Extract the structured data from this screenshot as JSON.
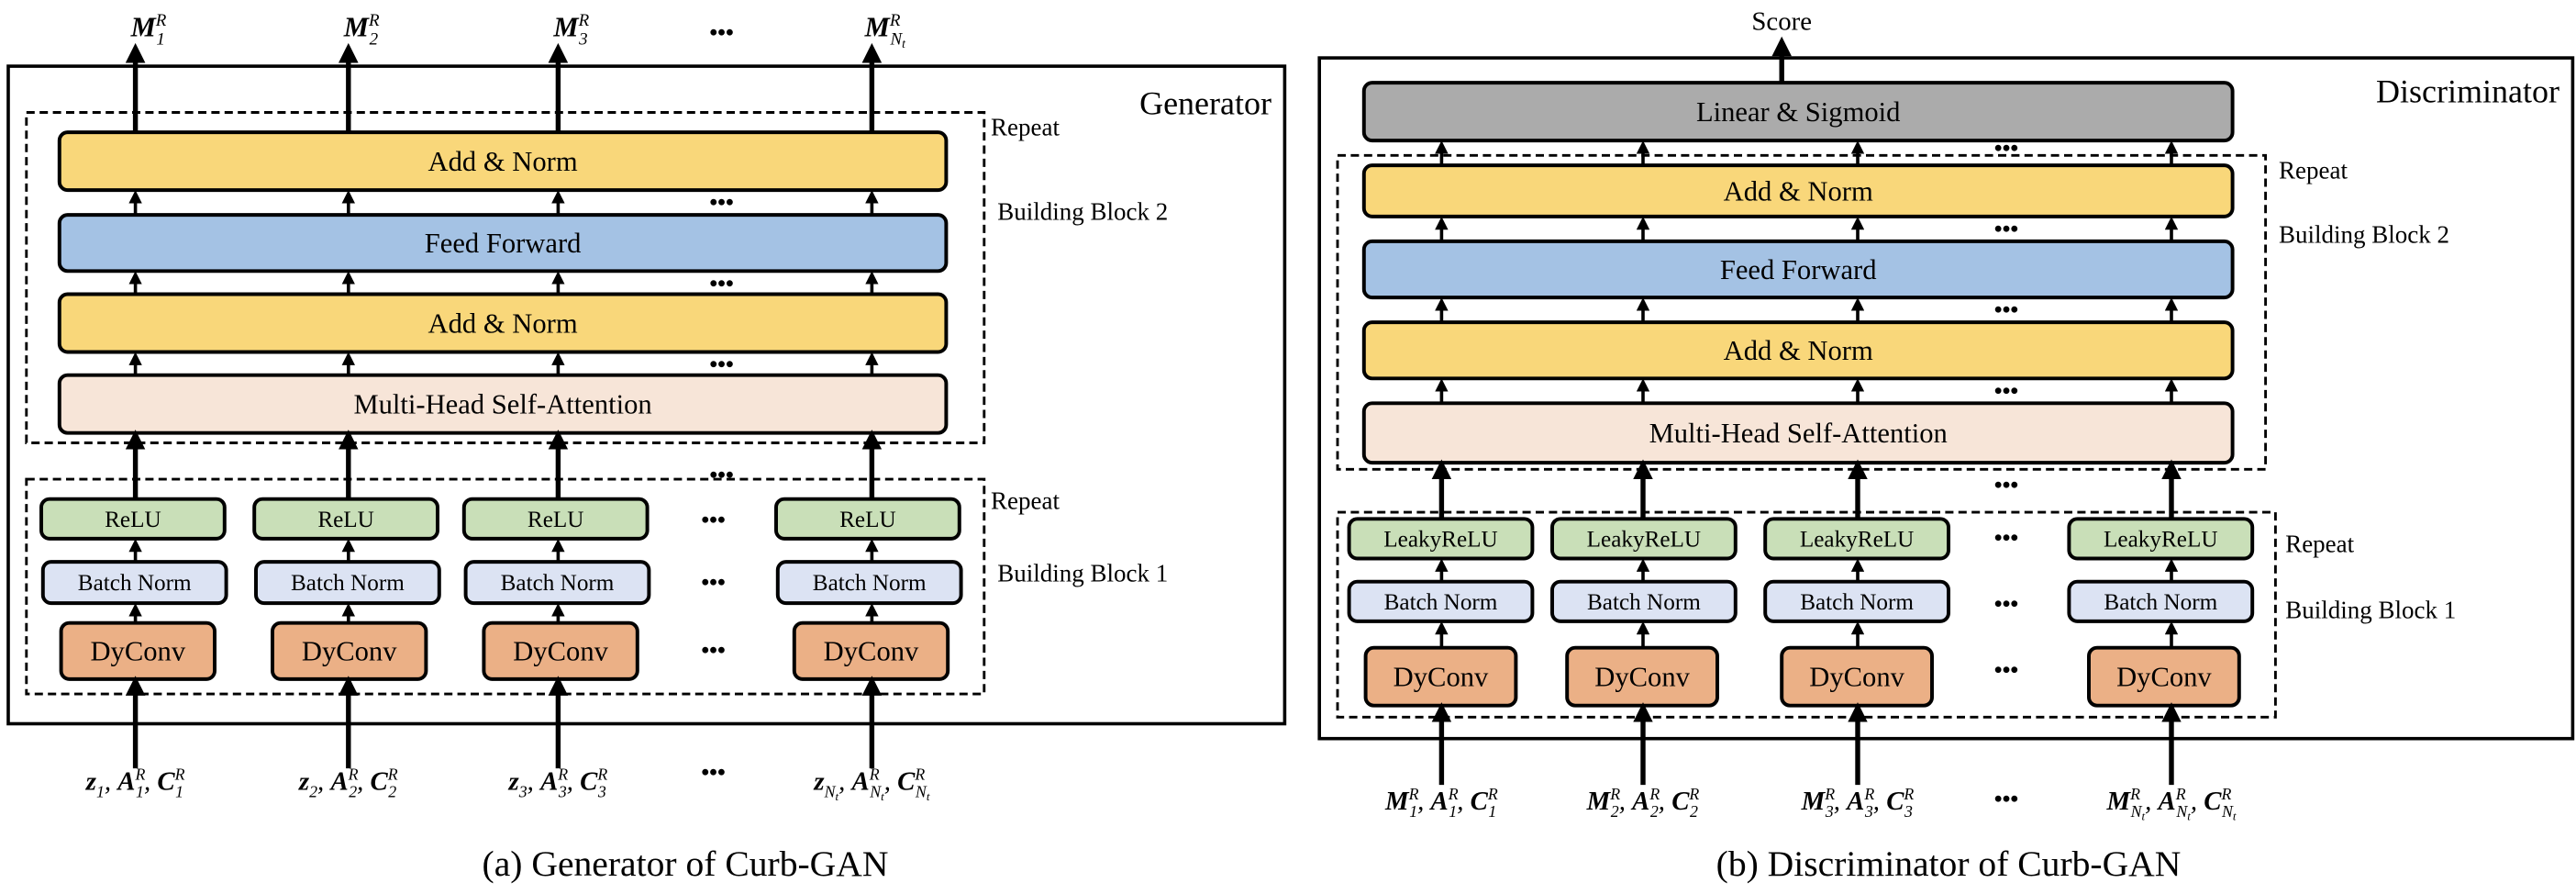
{
  "colors": {
    "add_norm": "#F9D77A",
    "feed_forward": "#A4C2E4",
    "attention": "#F7E5D8",
    "activation": "#C9DFB8",
    "batch_norm": "#DCE3F3",
    "dyconv": "#EBB086",
    "linear_sigmoid": "#ABABAB"
  },
  "ellipsis": "•••",
  "generator": {
    "title": "Generator",
    "caption": "(a) Generator of Curb-GAN",
    "block2": {
      "repeat": "Repeat",
      "label": "Building Block 2",
      "layers": [
        "Add & Norm",
        "Feed Forward",
        "Add & Norm",
        "Multi-Head Self-Attention"
      ]
    },
    "block1": {
      "repeat": "Repeat",
      "label": "Building Block 1",
      "activation": "ReLU",
      "norm": "Batch Norm",
      "conv": "DyConv"
    },
    "outputs": [
      [
        {
          "b": "M",
          "sup": "R",
          "sub": "1"
        }
      ],
      [
        {
          "b": "M",
          "sup": "R",
          "sub": "2"
        }
      ],
      [
        {
          "b": "M",
          "sup": "R",
          "sub": "3"
        }
      ],
      [
        {
          "b": "M",
          "sup": "R",
          "sub": "N",
          "subsub": "t"
        }
      ]
    ],
    "inputs": [
      [
        {
          "b": "z",
          "sub": "1"
        },
        {
          "b": "A",
          "sup": "R",
          "sub": "1"
        },
        {
          "b": "C",
          "sup": "R",
          "sub": "1"
        }
      ],
      [
        {
          "b": "z",
          "sub": "2"
        },
        {
          "b": "A",
          "sup": "R",
          "sub": "2"
        },
        {
          "b": "C",
          "sup": "R",
          "sub": "2"
        }
      ],
      [
        {
          "b": "z",
          "sub": "3"
        },
        {
          "b": "A",
          "sup": "R",
          "sub": "3"
        },
        {
          "b": "C",
          "sup": "R",
          "sub": "3"
        }
      ],
      [
        {
          "b": "z",
          "sub": "N",
          "subsub": "t"
        },
        {
          "b": "A",
          "sup": "R",
          "sub": "N",
          "subsub": "t"
        },
        {
          "b": "C",
          "sup": "R",
          "sub": "N",
          "subsub": "t"
        }
      ]
    ]
  },
  "discriminator": {
    "title": "Discriminator",
    "caption": "(b) Discriminator of Curb-GAN",
    "output": "Score",
    "head": "Linear & Sigmoid",
    "block2": {
      "repeat": "Repeat",
      "label": "Building Block 2",
      "layers": [
        "Add & Norm",
        "Feed Forward",
        "Add & Norm",
        "Multi-Head Self-Attention"
      ]
    },
    "block1": {
      "repeat": "Repeat",
      "label": "Building Block 1",
      "activation": "LeakyReLU",
      "norm": "Batch Norm",
      "conv": "DyConv"
    },
    "inputs": [
      [
        {
          "b": "M",
          "sup": "R",
          "sub": "1"
        },
        {
          "b": "A",
          "sup": "R",
          "sub": "1"
        },
        {
          "b": "C",
          "sup": "R",
          "sub": "1"
        }
      ],
      [
        {
          "b": "M",
          "sup": "R",
          "sub": "2"
        },
        {
          "b": "A",
          "sup": "R",
          "sub": "2"
        },
        {
          "b": "C",
          "sup": "R",
          "sub": "2"
        }
      ],
      [
        {
          "b": "M",
          "sup": "R",
          "sub": "3"
        },
        {
          "b": "A",
          "sup": "R",
          "sub": "3"
        },
        {
          "b": "C",
          "sup": "R",
          "sub": "3"
        }
      ],
      [
        {
          "b": "M",
          "sup": "R",
          "sub": "N",
          "subsub": "t"
        },
        {
          "b": "A",
          "sup": "R",
          "sub": "N",
          "subsub": "t"
        },
        {
          "b": "C",
          "sup": "R",
          "sub": "N",
          "subsub": "t"
        }
      ]
    ]
  }
}
